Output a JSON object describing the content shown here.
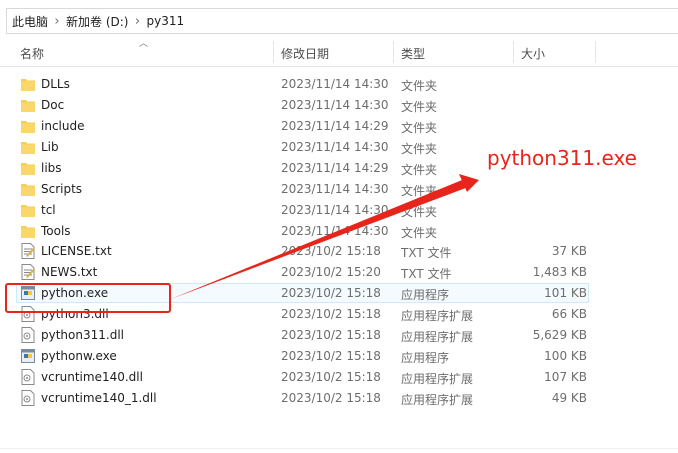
{
  "breadcrumb": [
    "此电脑",
    "新加卷 (D:)",
    "py311"
  ],
  "columns": {
    "name": "名称",
    "date": "修改日期",
    "type": "类型",
    "size": "大小"
  },
  "files": [
    {
      "name": "DLLs",
      "date": "2023/11/14 14:30",
      "type": "文件夹",
      "size": "",
      "icon": "folder-icon"
    },
    {
      "name": "Doc",
      "date": "2023/11/14 14:30",
      "type": "文件夹",
      "size": "",
      "icon": "folder-icon"
    },
    {
      "name": "include",
      "date": "2023/11/14 14:29",
      "type": "文件夹",
      "size": "",
      "icon": "folder-icon"
    },
    {
      "name": "Lib",
      "date": "2023/11/14 14:30",
      "type": "文件夹",
      "size": "",
      "icon": "folder-icon"
    },
    {
      "name": "libs",
      "date": "2023/11/14 14:29",
      "type": "文件夹",
      "size": "",
      "icon": "folder-icon"
    },
    {
      "name": "Scripts",
      "date": "2023/11/14 14:30",
      "type": "文件夹",
      "size": "",
      "icon": "folder-icon"
    },
    {
      "name": "tcl",
      "date": "2023/11/14 14:30",
      "type": "文件夹",
      "size": "",
      "icon": "folder-icon"
    },
    {
      "name": "Tools",
      "date": "2023/11/14 14:30",
      "type": "文件夹",
      "size": "",
      "icon": "folder-icon"
    },
    {
      "name": "LICENSE.txt",
      "date": "2023/10/2 15:18",
      "type": "TXT 文件",
      "size": "37 KB",
      "icon": "text-file-icon"
    },
    {
      "name": "NEWS.txt",
      "date": "2023/10/2 15:20",
      "type": "TXT 文件",
      "size": "1,483 KB",
      "icon": "text-file-icon"
    },
    {
      "name": "python.exe",
      "date": "2023/10/2 15:18",
      "type": "应用程序",
      "size": "101 KB",
      "icon": "python-exe-icon"
    },
    {
      "name": "python3.dll",
      "date": "2023/10/2 15:18",
      "type": "应用程序扩展",
      "size": "66 KB",
      "icon": "dll-file-icon"
    },
    {
      "name": "python311.dll",
      "date": "2023/10/2 15:18",
      "type": "应用程序扩展",
      "size": "5,629 KB",
      "icon": "dll-file-icon"
    },
    {
      "name": "pythonw.exe",
      "date": "2023/10/2 15:18",
      "type": "应用程序",
      "size": "100 KB",
      "icon": "python-exe-icon"
    },
    {
      "name": "vcruntime140.dll",
      "date": "2023/10/2 15:18",
      "type": "应用程序扩展",
      "size": "107 KB",
      "icon": "dll-file-icon"
    },
    {
      "name": "vcruntime140_1.dll",
      "date": "2023/10/2 15:18",
      "type": "应用程序扩展",
      "size": "49 KB",
      "icon": "dll-file-icon"
    }
  ],
  "annotation": {
    "text": "python311.exe",
    "color": "#e8251b"
  },
  "colors": {
    "folder": "#f8cf55",
    "accent": "#e8251b",
    "selection_border": "#cde8ff"
  }
}
